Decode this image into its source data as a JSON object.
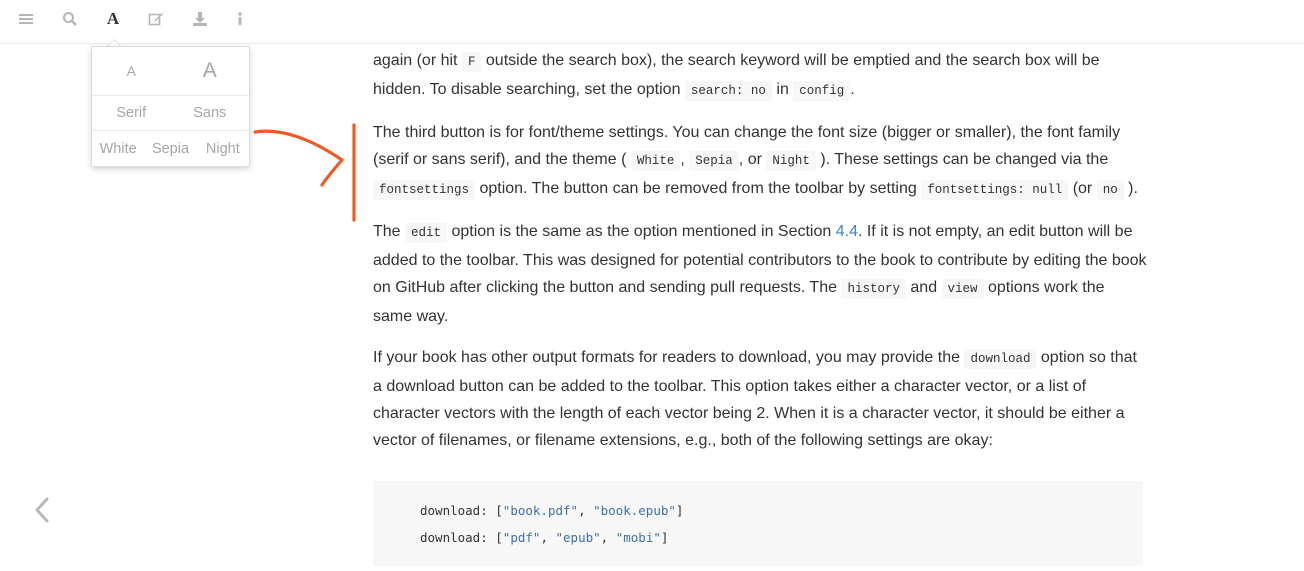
{
  "toolbar": {
    "font_button_label": "A",
    "icons": [
      "menu-icon",
      "search-icon",
      "font-settings-icon",
      "edit-icon",
      "download-icon",
      "info-icon"
    ]
  },
  "font_settings": {
    "size_small": "A",
    "size_big": "A",
    "families": [
      "Serif",
      "Sans"
    ],
    "themes": [
      "White",
      "Sepia",
      "Night"
    ]
  },
  "annotation_color": "#f15a22",
  "content": {
    "p1": {
      "t1": "again (or hit ",
      "c1": "F",
      "t2": " outside the search box), the search keyword will be emptied and the search box will be hidden. To disable searching, set the option ",
      "c2": "search: no",
      "t3": " in ",
      "c3": "config",
      "t4": "."
    },
    "p2": {
      "t1": "The third button is for font/theme settings. You can change the font size (bigger or smaller), the font family (serif or sans serif), and the theme ( ",
      "c1": "White",
      "t2": ", ",
      "c2": "Sepia",
      "t3": ", or ",
      "c3": "Night",
      "t4": " ). These settings can be changed via the ",
      "c4": "fontsettings",
      "t5": " option. The button can be removed from the toolbar by setting ",
      "c5": "fontsettings: null",
      "t6": " (or ",
      "c6": "no",
      "t7": " )."
    },
    "p3": {
      "t1": "The ",
      "c1": "edit",
      "t2": " option is the same as the option mentioned in Section ",
      "link": "4.4",
      "t3": ". If it is not empty, an edit button will be added to the toolbar. This was designed for potential contributors to the book to contribute by editing the book on GitHub after clicking the button and sending pull requests. The ",
      "c2": "history",
      "t4": " and ",
      "c3": "view",
      "t5": " options work the same way."
    },
    "p4": {
      "t1": "If your book has other output formats for readers to download, you may provide the ",
      "c1": "download",
      "t2": " option so that a download button can be added to the toolbar. This option takes either a character vector, or a list of character vectors with the length of each vector being 2. When it is a character vector, it should be either a vector of filenames, or filename extensions, e.g., both of the following settings are okay:"
    }
  },
  "code": {
    "line1": {
      "key": "download: [",
      "s1": "\"book.pdf\"",
      "sep": ", ",
      "s2": "\"book.epub\"",
      "end": "]"
    },
    "line2": {
      "key": "download: [",
      "s1": "\"pdf\"",
      "sep1": ", ",
      "s2": "\"epub\"",
      "sep2": ", ",
      "s3": "\"mobi\"",
      "end": "]"
    }
  },
  "nav": {
    "prev_icon": "chevron-left-icon"
  }
}
